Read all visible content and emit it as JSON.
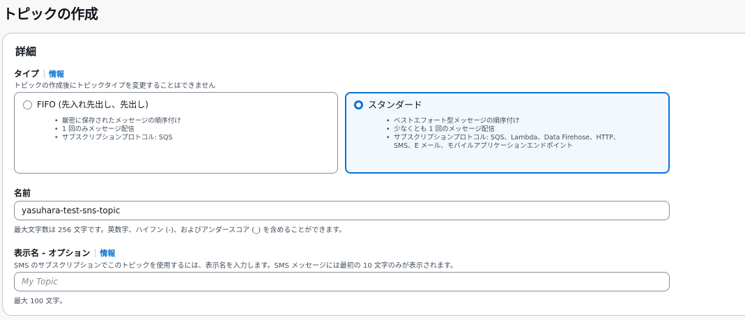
{
  "page": {
    "title": "トピックの作成"
  },
  "details": {
    "section_title": "詳細",
    "type": {
      "label": "タイプ",
      "info_link": "情報",
      "description": "トピックの作成後にトピックタイプを変更することはできません",
      "options": [
        {
          "title": "FIFO (先入れ先出し、先出し)",
          "selected": false,
          "bullets": [
            "厳密に保存されたメッセージの順序付け",
            "1 回のみメッセージ配信",
            "サブスクリプションプロトコル: SQS"
          ]
        },
        {
          "title": "スタンダード",
          "selected": true,
          "bullets": [
            "ベストエフォート型メッセージの順序付け",
            "少なくとも 1 回のメッセージ配信",
            "サブスクリプションプロトコル: SQS、Lambda、Data Firehose、HTTP、",
            "SMS、E メール、モバイルアプリケーションエンドポイント"
          ]
        }
      ]
    },
    "name": {
      "label": "名前",
      "value": "yasuhara-test-sns-topic",
      "constraint": "最大文字数は 256 文字です。英数字、ハイフン (-)、およびアンダースコア (_) を含めることができます。"
    },
    "display_name": {
      "label": "表示名 - オプション",
      "info_link": "情報",
      "description": "SMS のサブスクリプションでこのトピックを使用するには、表示名を入力します。SMS メッセージには最初の 10 文字のみが表示されます。",
      "placeholder": "My Topic",
      "value": "",
      "constraint": "最大 100 文字。"
    }
  },
  "colors": {
    "accent": "#0972d3",
    "selected_tile_bg": "#f2f8fd",
    "border": "#8c8c94",
    "secondary_text": "#414d5c"
  }
}
